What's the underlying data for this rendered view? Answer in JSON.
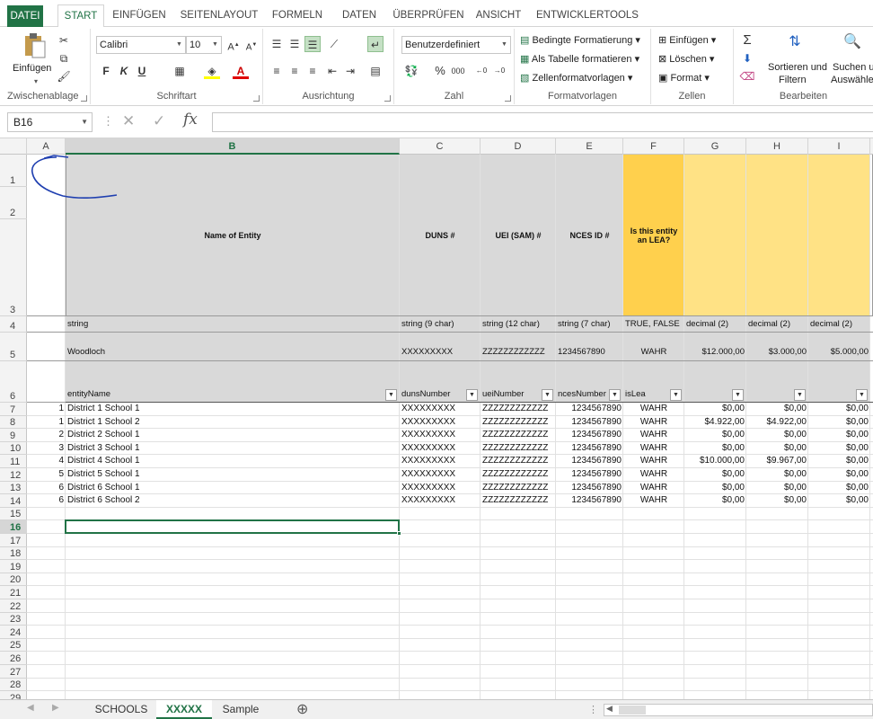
{
  "ribbon_tabs": [
    "DATEI",
    "START",
    "EINFÜGEN",
    "SEITENLAYOUT",
    "FORMELN",
    "DATEN",
    "ÜBERPRÜFEN",
    "ANSICHT",
    "ENTWICKLERTOOLS"
  ],
  "clipboard": {
    "paste_label": "Einfügen",
    "group": "Zwischenablage"
  },
  "font": {
    "name": "Calibri",
    "size": "10",
    "bold": "F",
    "italic": "K",
    "underline": "U",
    "group": "Schriftart"
  },
  "alignment": {
    "group": "Ausrichtung"
  },
  "number": {
    "format": "Benutzerdefiniert",
    "percent": "%",
    "thousands": "000",
    "group": "Zahl"
  },
  "styles": {
    "conditional": "Bedingte Formatierung",
    "as_table": "Als Tabelle formatieren",
    "cell_styles": "Zellenformatvorlagen",
    "group": "Formatvorlagen"
  },
  "cells_group": {
    "insert": "Einfügen",
    "delete": "Löschen",
    "format": "Format",
    "group": "Zellen"
  },
  "editing": {
    "sort": "Sortieren und",
    "sort2": "Filtern",
    "find": "Suchen u",
    "find2": "Auswähle",
    "group": "Bearbeiten"
  },
  "formula_bar": {
    "name_box": "B16",
    "fx": "fx",
    "value": ""
  },
  "columns": [
    "A",
    "B",
    "C",
    "D",
    "E",
    "F",
    "G",
    "H",
    "I"
  ],
  "rows": [
    "1",
    "2",
    "3",
    "4",
    "5",
    "6",
    "7",
    "8",
    "9",
    "10",
    "11",
    "12",
    "13",
    "14",
    "15",
    "16",
    "17",
    "18",
    "19",
    "20",
    "21",
    "22",
    "23",
    "24",
    "25",
    "26",
    "27",
    "28",
    "29"
  ],
  "header": {
    "b": "Name of Entity",
    "c": "DUNS #",
    "d": "UEI (SAM) #",
    "e": "NCES ID #",
    "f1": "Is this entity",
    "f2": "an LEA?"
  },
  "types": {
    "b": "string",
    "c": "string (9 char)",
    "d": "string (12 char)",
    "e": "string (7 char)",
    "f": "TRUE, FALSE",
    "g": "decimal (2)",
    "h": "decimal (2)",
    "i": "decimal (2)"
  },
  "example": {
    "b": "Woodloch",
    "c": "XXXXXXXXX",
    "d": "ZZZZZZZZZZZZ",
    "e": "1234567890",
    "f": "WAHR",
    "g": "$12.000,00",
    "h": "$3.000,00",
    "i": "$5.000,00"
  },
  "fields": {
    "b": "entityName",
    "c": "dunsNumber",
    "d": "ueiNumber",
    "e": "ncesNumber",
    "f": "isLea"
  },
  "data_rows": [
    {
      "a": "1",
      "b": "District 1 School 1",
      "c": "XXXXXXXXX",
      "d": "ZZZZZZZZZZZZ",
      "e": "1234567890",
      "f": "WAHR",
      "g": "$0,00",
      "h": "$0,00",
      "i": "$0,00"
    },
    {
      "a": "1",
      "b": "District 1 School 2",
      "c": "XXXXXXXXX",
      "d": "ZZZZZZZZZZZZ",
      "e": "1234567890",
      "f": "WAHR",
      "g": "$4.922,00",
      "h": "$4.922,00",
      "i": "$0,00"
    },
    {
      "a": "2",
      "b": "District 2 School 1",
      "c": "XXXXXXXXX",
      "d": "ZZZZZZZZZZZZ",
      "e": "1234567890",
      "f": "WAHR",
      "g": "$0,00",
      "h": "$0,00",
      "i": "$0,00"
    },
    {
      "a": "3",
      "b": "District 3 School 1",
      "c": "XXXXXXXXX",
      "d": "ZZZZZZZZZZZZ",
      "e": "1234567890",
      "f": "WAHR",
      "g": "$0,00",
      "h": "$0,00",
      "i": "$0,00"
    },
    {
      "a": "4",
      "b": "District 4 School 1",
      "c": "XXXXXXXXX",
      "d": "ZZZZZZZZZZZZ",
      "e": "1234567890",
      "f": "WAHR",
      "g": "$10.000,00",
      "h": "$9.967,00",
      "i": "$0,00"
    },
    {
      "a": "5",
      "b": "District 5 School 1",
      "c": "XXXXXXXXX",
      "d": "ZZZZZZZZZZZZ",
      "e": "1234567890",
      "f": "WAHR",
      "g": "$0,00",
      "h": "$0,00",
      "i": "$0,00"
    },
    {
      "a": "6",
      "b": "District 6 School 1",
      "c": "XXXXXXXXX",
      "d": "ZZZZZZZZZZZZ",
      "e": "1234567890",
      "f": "WAHR",
      "g": "$0,00",
      "h": "$0,00",
      "i": "$0,00"
    },
    {
      "a": "6",
      "b": "District 6 School 2",
      "c": "XXXXXXXXX",
      "d": "ZZZZZZZZZZZZ",
      "e": "1234567890",
      "f": "WAHR",
      "g": "$0,00",
      "h": "$0,00",
      "i": "$0,00"
    }
  ],
  "sheets": [
    "SCHOOLS",
    "XXXXX",
    "Sample"
  ],
  "colors": {
    "accent": "#217346",
    "header_gray": "#d9d9d9",
    "header_orange": "#ffd04d",
    "header_yellow": "#ffe285",
    "annotation": "#1f3fb0"
  }
}
